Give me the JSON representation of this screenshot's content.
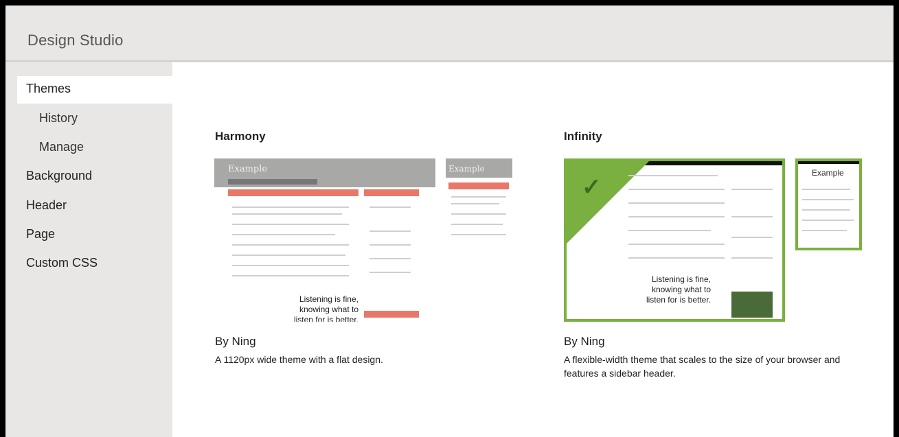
{
  "app": {
    "title": "Design Studio"
  },
  "sidebar": {
    "items": [
      {
        "label": "Themes",
        "active": true
      },
      {
        "label": "History",
        "sub": true
      },
      {
        "label": "Manage",
        "sub": true
      },
      {
        "label": "Background"
      },
      {
        "label": "Header"
      },
      {
        "label": "Page"
      },
      {
        "label": "Custom CSS"
      }
    ]
  },
  "themes": [
    {
      "name": "Harmony",
      "author": "By Ning",
      "description": "A 1120px wide theme with a flat design.",
      "preview_title": "Example",
      "preview_tagline": "Listening is fine, knowing what to listen for is better.",
      "selected": false
    },
    {
      "name": "Infinity",
      "author": "By Ning",
      "description": "A flexible-width theme that scales to the size of your browser and features a sidebar header.",
      "preview_title": "Example",
      "preview_tagline": "Listening is fine, knowing what to listen for is better.",
      "selected": true
    }
  ],
  "colors": {
    "accent_green": "#7ab040",
    "harmony_orange": "#e8786a"
  }
}
